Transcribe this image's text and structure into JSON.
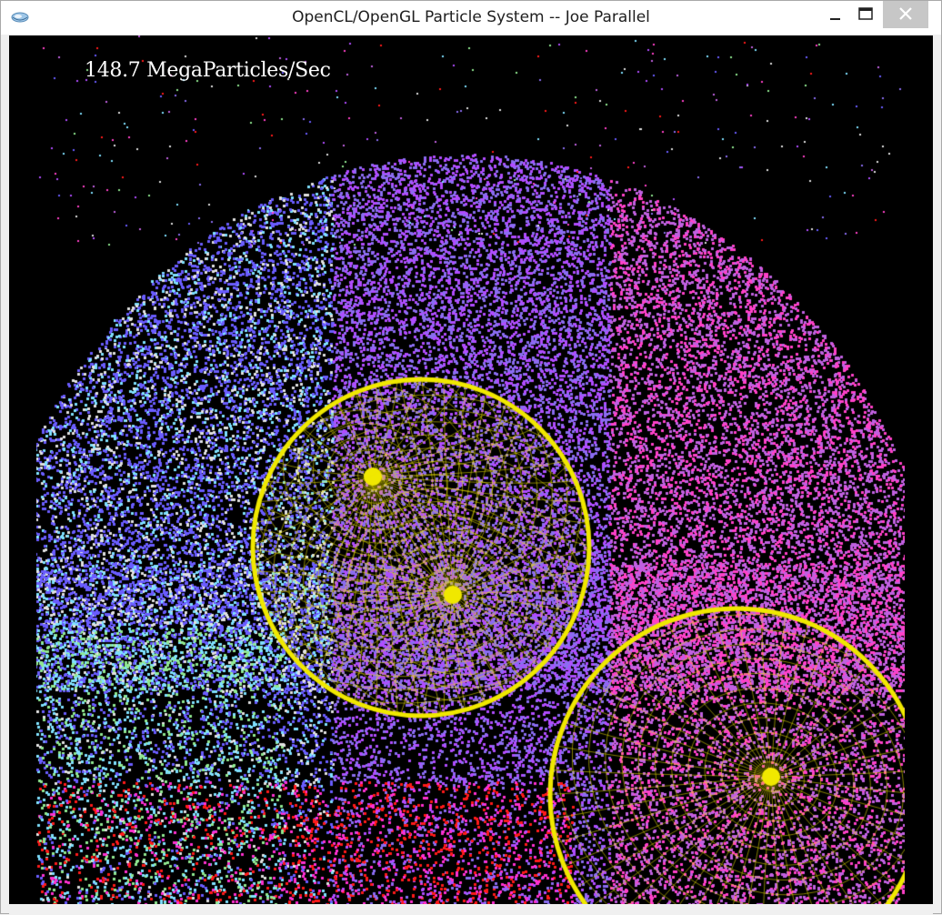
{
  "window": {
    "title": "OpenCL/OpenGL Particle System -- Joe Parallel",
    "controls": {
      "minimize": "minimize",
      "maximize": "maximize",
      "close": "close"
    }
  },
  "viewport": {
    "hud_text": "148.7 MegaParticles/Sec",
    "background": "#000000",
    "sphere_color": "#f0e800",
    "particle_palette": [
      "#6a5cff",
      "#8a6cf0",
      "#c060e0",
      "#ff40c8",
      "#ff1a1a",
      "#7fe0ff",
      "#90e890",
      "#e0e0e0",
      "#b04cff"
    ]
  }
}
